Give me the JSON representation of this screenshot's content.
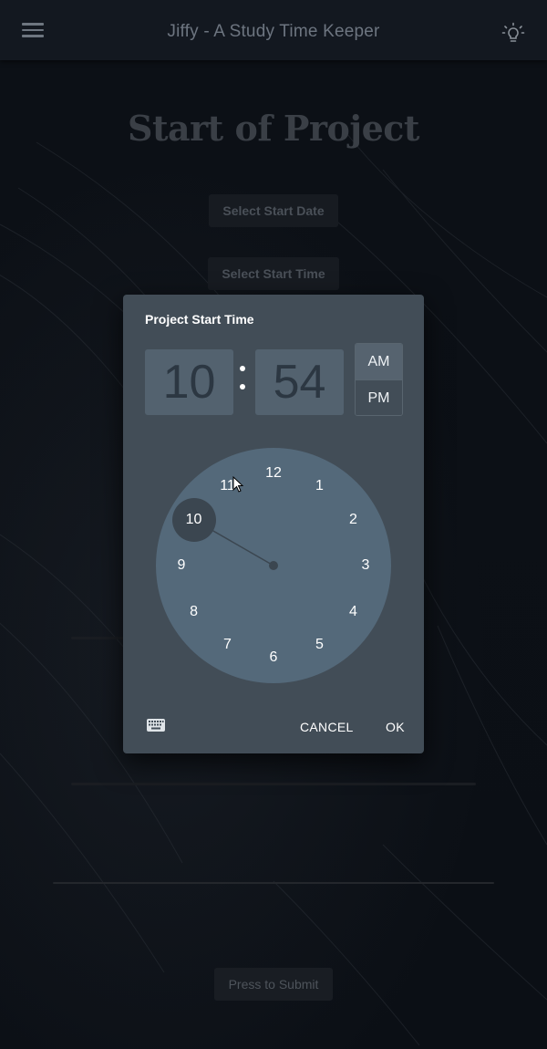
{
  "app": {
    "title": "Jiffy - A Study Time Keeper",
    "menu_icon": "hamburger-menu-icon",
    "theme_icon": "lightbulb-icon"
  },
  "page": {
    "heading": "Start of Project",
    "select_date_label": "Select Start Date",
    "select_time_label": "Select Start Time",
    "submit_label": "Press to Submit"
  },
  "dialog": {
    "title": "Project Start Time",
    "hour": "10",
    "minute": "54",
    "colon": ":",
    "am_label": "AM",
    "pm_label": "PM",
    "selected_period": "AM",
    "clock_numbers": [
      "12",
      "1",
      "2",
      "3",
      "4",
      "5",
      "6",
      "7",
      "8",
      "9",
      "10",
      "11"
    ],
    "selected_hour": "10",
    "keyboard_icon": "keyboard-icon",
    "cancel_label": "CANCEL",
    "ok_label": "OK"
  },
  "colors": {
    "dialog_bg": "#424d57",
    "clock_face": "#54697a",
    "selected_hour_bg": "#3b4650",
    "appbar_bg": "#131820"
  }
}
